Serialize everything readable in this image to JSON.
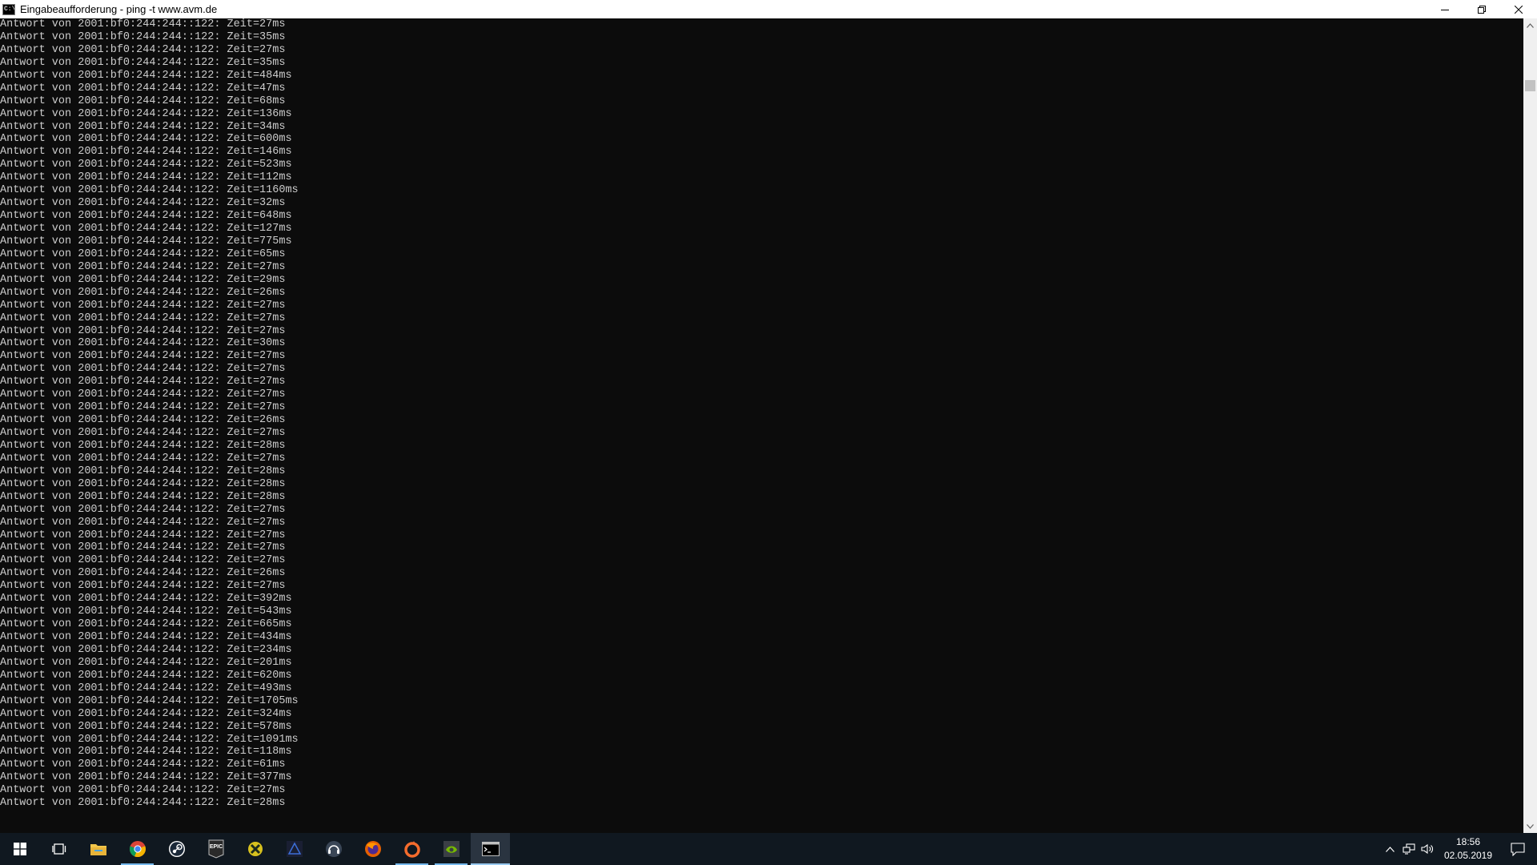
{
  "window": {
    "title": "Eingabeaufforderung - ping  -t www.avm.de",
    "icon_text": "C:\\"
  },
  "console": {
    "lines": [
      "Antwort von 2001:bf0:244:244::122: Zeit=27ms",
      "Antwort von 2001:bf0:244:244::122: Zeit=35ms",
      "Antwort von 2001:bf0:244:244::122: Zeit=27ms",
      "Antwort von 2001:bf0:244:244::122: Zeit=35ms",
      "Antwort von 2001:bf0:244:244::122: Zeit=484ms",
      "Antwort von 2001:bf0:244:244::122: Zeit=47ms",
      "Antwort von 2001:bf0:244:244::122: Zeit=68ms",
      "Antwort von 2001:bf0:244:244::122: Zeit=136ms",
      "Antwort von 2001:bf0:244:244::122: Zeit=34ms",
      "Antwort von 2001:bf0:244:244::122: Zeit=600ms",
      "Antwort von 2001:bf0:244:244::122: Zeit=146ms",
      "Antwort von 2001:bf0:244:244::122: Zeit=523ms",
      "Antwort von 2001:bf0:244:244::122: Zeit=112ms",
      "Antwort von 2001:bf0:244:244::122: Zeit=1160ms",
      "Antwort von 2001:bf0:244:244::122: Zeit=32ms",
      "Antwort von 2001:bf0:244:244::122: Zeit=648ms",
      "Antwort von 2001:bf0:244:244::122: Zeit=127ms",
      "Antwort von 2001:bf0:244:244::122: Zeit=775ms",
      "Antwort von 2001:bf0:244:244::122: Zeit=65ms",
      "Antwort von 2001:bf0:244:244::122: Zeit=27ms",
      "Antwort von 2001:bf0:244:244::122: Zeit=29ms",
      "Antwort von 2001:bf0:244:244::122: Zeit=26ms",
      "Antwort von 2001:bf0:244:244::122: Zeit=27ms",
      "Antwort von 2001:bf0:244:244::122: Zeit=27ms",
      "Antwort von 2001:bf0:244:244::122: Zeit=27ms",
      "Antwort von 2001:bf0:244:244::122: Zeit=30ms",
      "Antwort von 2001:bf0:244:244::122: Zeit=27ms",
      "Antwort von 2001:bf0:244:244::122: Zeit=27ms",
      "Antwort von 2001:bf0:244:244::122: Zeit=27ms",
      "Antwort von 2001:bf0:244:244::122: Zeit=27ms",
      "Antwort von 2001:bf0:244:244::122: Zeit=27ms",
      "Antwort von 2001:bf0:244:244::122: Zeit=26ms",
      "Antwort von 2001:bf0:244:244::122: Zeit=27ms",
      "Antwort von 2001:bf0:244:244::122: Zeit=28ms",
      "Antwort von 2001:bf0:244:244::122: Zeit=27ms",
      "Antwort von 2001:bf0:244:244::122: Zeit=28ms",
      "Antwort von 2001:bf0:244:244::122: Zeit=28ms",
      "Antwort von 2001:bf0:244:244::122: Zeit=28ms",
      "Antwort von 2001:bf0:244:244::122: Zeit=27ms",
      "Antwort von 2001:bf0:244:244::122: Zeit=27ms",
      "Antwort von 2001:bf0:244:244::122: Zeit=27ms",
      "Antwort von 2001:bf0:244:244::122: Zeit=27ms",
      "Antwort von 2001:bf0:244:244::122: Zeit=27ms",
      "Antwort von 2001:bf0:244:244::122: Zeit=26ms",
      "Antwort von 2001:bf0:244:244::122: Zeit=27ms",
      "Antwort von 2001:bf0:244:244::122: Zeit=392ms",
      "Antwort von 2001:bf0:244:244::122: Zeit=543ms",
      "Antwort von 2001:bf0:244:244::122: Zeit=665ms",
      "Antwort von 2001:bf0:244:244::122: Zeit=434ms",
      "Antwort von 2001:bf0:244:244::122: Zeit=234ms",
      "Antwort von 2001:bf0:244:244::122: Zeit=201ms",
      "Antwort von 2001:bf0:244:244::122: Zeit=620ms",
      "Antwort von 2001:bf0:244:244::122: Zeit=493ms",
      "Antwort von 2001:bf0:244:244::122: Zeit=1705ms",
      "Antwort von 2001:bf0:244:244::122: Zeit=324ms",
      "Antwort von 2001:bf0:244:244::122: Zeit=578ms",
      "Antwort von 2001:bf0:244:244::122: Zeit=1091ms",
      "Antwort von 2001:bf0:244:244::122: Zeit=118ms",
      "Antwort von 2001:bf0:244:244::122: Zeit=61ms",
      "Antwort von 2001:bf0:244:244::122: Zeit=377ms",
      "Antwort von 2001:bf0:244:244::122: Zeit=27ms",
      "Antwort von 2001:bf0:244:244::122: Zeit=28ms"
    ]
  },
  "taskbar": {
    "buttons": [
      {
        "name": "windows-start",
        "icon": "windows-logo-icon",
        "state": "none"
      },
      {
        "name": "task-view",
        "icon": "task-view-icon",
        "state": "none"
      },
      {
        "name": "file-explorer",
        "icon": "folder-icon",
        "state": "none"
      },
      {
        "name": "chrome",
        "icon": "chrome-icon",
        "state": "open"
      },
      {
        "name": "steam",
        "icon": "steam-icon",
        "state": "none"
      },
      {
        "name": "epic-games",
        "icon": "epic-games-icon",
        "state": "none",
        "label": "EPIC"
      },
      {
        "name": "app-yellow",
        "icon": "shield-app-icon",
        "state": "none"
      },
      {
        "name": "app-dark",
        "icon": "game-app-icon",
        "state": "none"
      },
      {
        "name": "headset-app",
        "icon": "headset-icon",
        "state": "none"
      },
      {
        "name": "firefox",
        "icon": "firefox-icon",
        "state": "none"
      },
      {
        "name": "origin",
        "icon": "origin-icon",
        "state": "open"
      },
      {
        "name": "nvidia",
        "icon": "nvidia-icon",
        "state": "open"
      },
      {
        "name": "command-prompt",
        "icon": "cmd-icon",
        "state": "active"
      }
    ],
    "tray": {
      "time": "18:56",
      "date": "02.05.2019"
    }
  },
  "colors": {
    "console_bg": "#0c0c0c",
    "console_text": "#cccccc",
    "taskbar_bg": "#101820",
    "taskbar_accent": "#76b9ed"
  }
}
